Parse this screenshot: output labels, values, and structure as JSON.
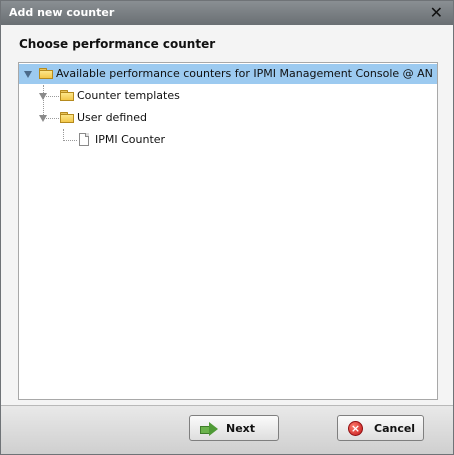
{
  "dialog": {
    "title": "Add new counter",
    "close_label": "✕",
    "heading": "Choose performance counter"
  },
  "tree": {
    "root": {
      "label": "Available performance counters for IPMI Management Console @ AN",
      "selected": true,
      "expanded": true
    },
    "children": [
      {
        "label": "Counter templates",
        "expanded": true
      },
      {
        "label": "User defined",
        "expanded": true,
        "children": [
          {
            "label": "IPMI Counter"
          }
        ]
      }
    ]
  },
  "footer": {
    "next_label": "Next",
    "cancel_label": "Cancel"
  },
  "icons": {
    "root": "folder-open-icon",
    "child_folder": "folder-icon",
    "leaf": "document-icon",
    "next": "arrow-right-icon",
    "cancel": "cancel-icon"
  },
  "colors": {
    "selection": "#9ccaf0",
    "titlebar": "#7a7f83"
  }
}
